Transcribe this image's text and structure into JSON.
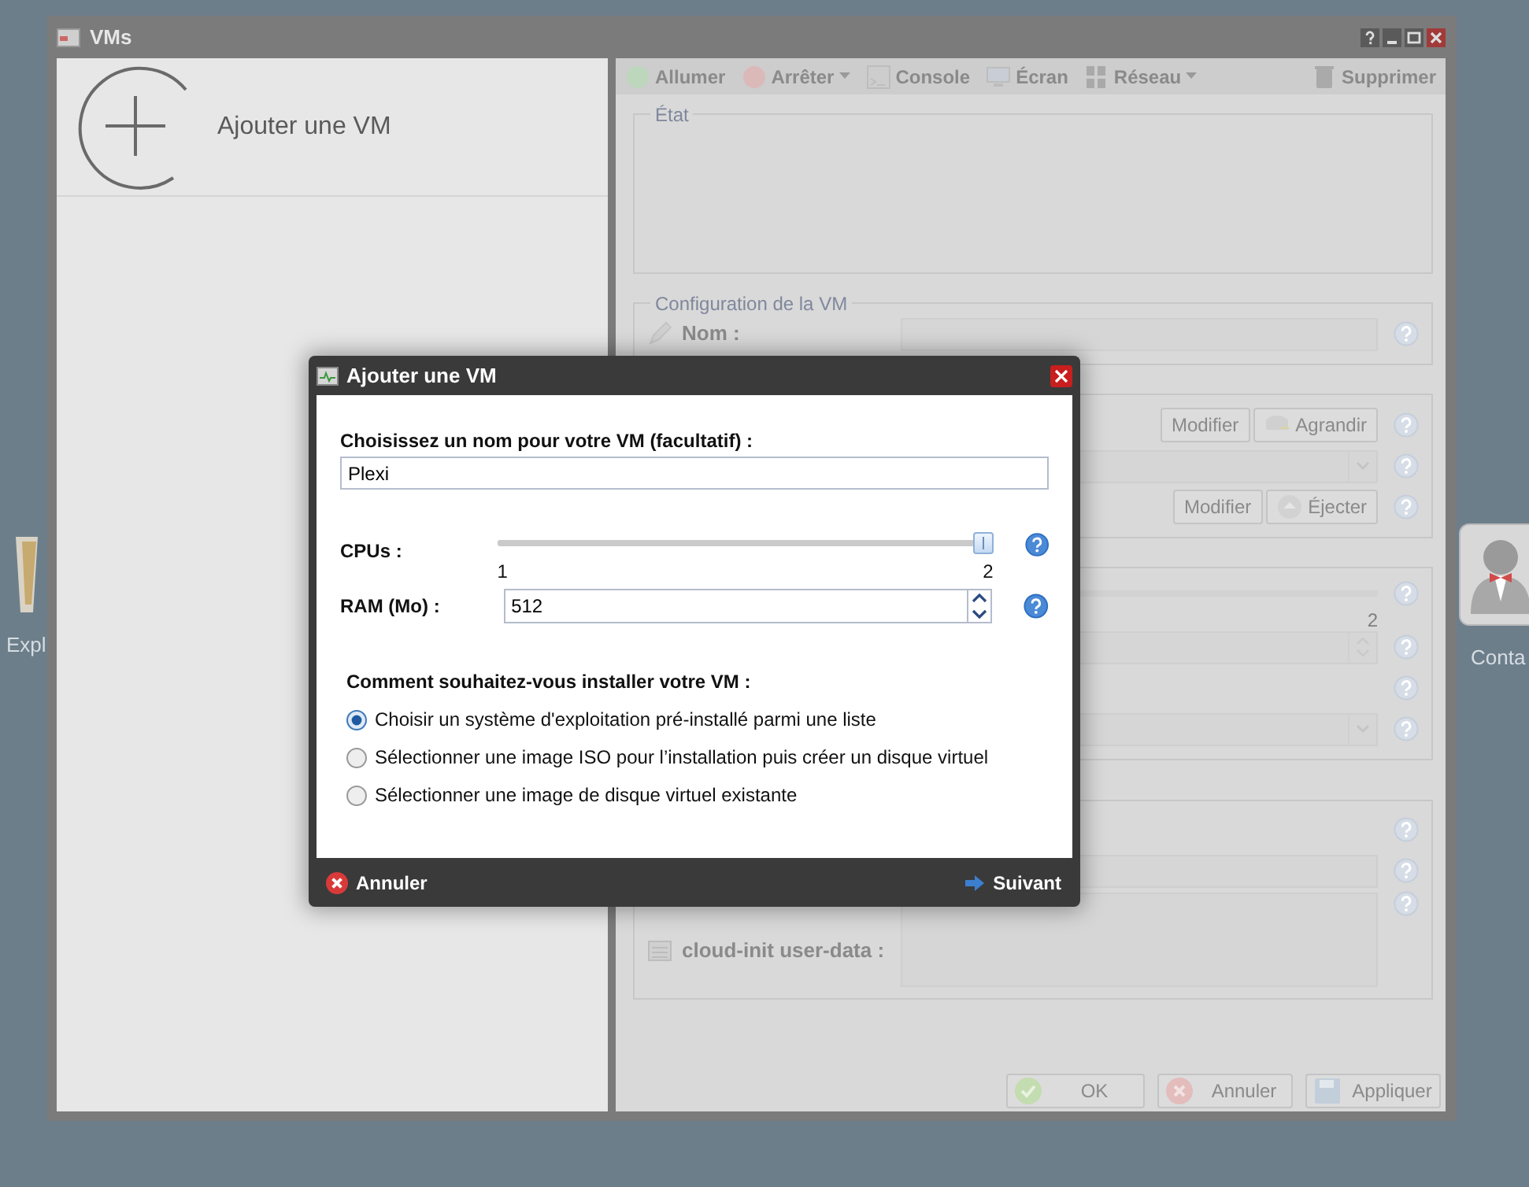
{
  "desktop_icons": [
    {
      "label": "Expl",
      "kind": "folder"
    },
    {
      "label": "Conta",
      "kind": "contact"
    }
  ],
  "window": {
    "title": "VMs"
  },
  "vm_list": {
    "add_label": "Ajouter une VM"
  },
  "toolbar": [
    {
      "label": "Allumer",
      "kind": "power-on",
      "dropdown": false
    },
    {
      "label": "Arrêter",
      "kind": "power-off",
      "dropdown": true
    },
    {
      "label": "Console",
      "kind": "console",
      "dropdown": false
    },
    {
      "label": "Écran",
      "kind": "screen",
      "dropdown": false
    },
    {
      "label": "Réseau",
      "kind": "network",
      "dropdown": true
    },
    {
      "label": "Supprimer",
      "kind": "trash",
      "dropdown": false
    }
  ],
  "sections": [
    {
      "legend": "État",
      "rows": [
        {
          "kind": "status"
        }
      ]
    },
    {
      "legend": "Configuration de la VM",
      "rows": [
        {
          "kind": "field",
          "label": "Nom :"
        }
      ]
    },
    {
      "rows": [
        {
          "kind": "buttons",
          "buttons": [
            {
              "label": "Modifier",
              "kind": "plain"
            },
            {
              "label": "Agrandir",
              "kind": "resize"
            }
          ]
        },
        {
          "kind": "select"
        },
        {
          "kind": "buttons",
          "buttons": [
            {
              "label": "Modifier",
              "kind": "plain"
            },
            {
              "label": "Éjecter",
              "kind": "eject"
            }
          ]
        }
      ]
    },
    {
      "rows": [
        {
          "kind": "slider"
        },
        {
          "kind": "scale",
          "label": "2"
        },
        {
          "kind": "spinner"
        },
        {
          "kind": "blank"
        },
        {
          "kind": "select"
        }
      ]
    },
    {
      "rows": [
        {
          "kind": "blank"
        },
        {
          "kind": "field"
        },
        {
          "kind": "textarea",
          "label": "cloud-init user-data :"
        }
      ]
    }
  ],
  "footer_buttons": [
    {
      "label": "OK",
      "kind": "ok"
    },
    {
      "label": "Annuler",
      "kind": "cancel"
    },
    {
      "label": "Appliquer",
      "kind": "apply"
    }
  ],
  "dialog": {
    "title": "Ajouter une VM",
    "name_label": "Choisissez un nom pour votre VM (facultatif) :",
    "name_value": "Plexi",
    "cpus": {
      "label": "CPUs :",
      "level": 1,
      "min": "1",
      "max": "2"
    },
    "ram": {
      "label": "RAM (Mo) :",
      "value": "512"
    },
    "install_label": "Comment souhaitez-vous installer votre VM :",
    "options": [
      {
        "label": "Choisir un système d'exploitation pré-installé parmi une liste",
        "selected": true
      },
      {
        "label": "Sélectionner une image ISO pour l’installation puis créer un disque virtuel",
        "selected": false
      },
      {
        "label": "Sélectionner une image de disque virtuel existante",
        "selected": false
      }
    ],
    "cancel": "Annuler",
    "next": "Suivant"
  }
}
